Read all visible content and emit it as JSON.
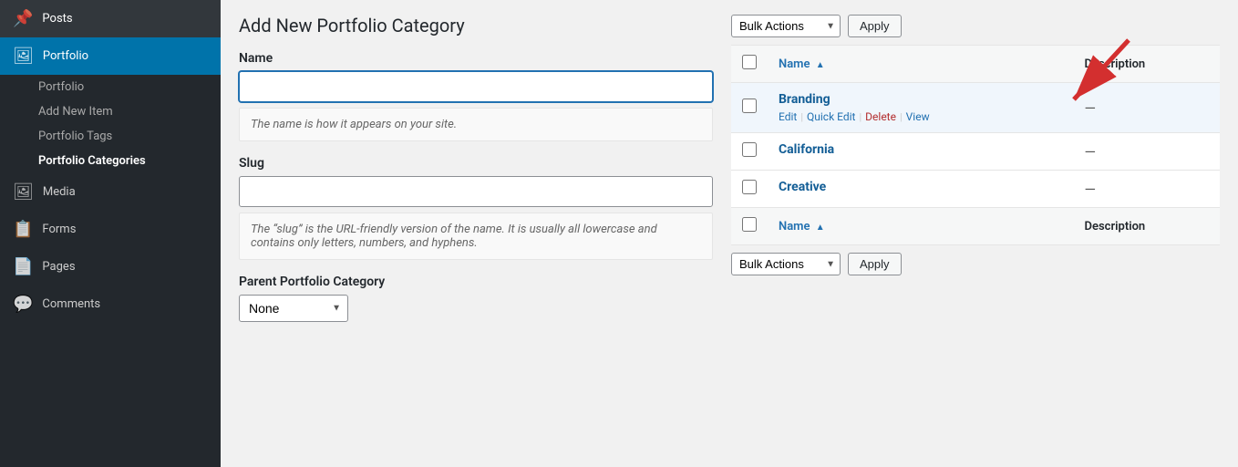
{
  "sidebar": {
    "items": [
      {
        "id": "posts",
        "label": "Posts",
        "icon": "📌"
      },
      {
        "id": "portfolio",
        "label": "Portfolio",
        "icon": "🖼",
        "active": true
      }
    ],
    "sub_items": [
      {
        "id": "portfolio-main",
        "label": "Portfolio"
      },
      {
        "id": "add-new-item",
        "label": "Add New Item"
      },
      {
        "id": "portfolio-tags",
        "label": "Portfolio Tags"
      },
      {
        "id": "portfolio-categories",
        "label": "Portfolio Categories",
        "active": true
      }
    ],
    "other_items": [
      {
        "id": "media",
        "label": "Media",
        "icon": "🖼"
      },
      {
        "id": "forms",
        "label": "Forms",
        "icon": "📋"
      },
      {
        "id": "pages",
        "label": "Pages",
        "icon": "📄"
      },
      {
        "id": "comments",
        "label": "Comments",
        "icon": "💬"
      }
    ]
  },
  "form": {
    "title": "Add New Portfolio Category",
    "name_label": "Name",
    "name_placeholder": "",
    "name_hint": "The name is how it appears on your site.",
    "slug_label": "Slug",
    "slug_placeholder": "",
    "slug_hint": "The “slug” is the URL-friendly version of the name. It is usually all lowercase and contains only letters, numbers, and hyphens.",
    "parent_label": "Parent Portfolio Category",
    "parent_options": [
      "None"
    ],
    "parent_selected": "None"
  },
  "table": {
    "toolbar_top": {
      "bulk_actions_label": "Bulk Actions",
      "apply_label": "Apply"
    },
    "toolbar_bottom": {
      "bulk_actions_label": "Bulk Actions",
      "apply_label": "Apply"
    },
    "columns": [
      {
        "id": "check",
        "label": ""
      },
      {
        "id": "name",
        "label": "Name",
        "sorted": true,
        "sort_dir": "asc"
      },
      {
        "id": "description",
        "label": "Description"
      }
    ],
    "rows": [
      {
        "id": "branding",
        "name": "Branding",
        "description": "—",
        "actions": [
          "Edit",
          "Quick Edit",
          "Delete",
          "View"
        ],
        "highlighted": true
      },
      {
        "id": "california",
        "name": "California",
        "description": "—",
        "actions": []
      },
      {
        "id": "creative",
        "name": "Creative",
        "description": "—",
        "actions": []
      }
    ],
    "footer_columns": [
      {
        "id": "name",
        "label": "Name",
        "sorted": true
      },
      {
        "id": "description",
        "label": "Description"
      }
    ]
  }
}
